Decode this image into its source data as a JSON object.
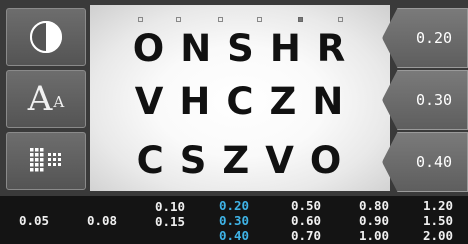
{
  "tools": [
    {
      "name": "contrast-icon"
    },
    {
      "name": "font-size-icon",
      "label_big": "A",
      "label_small": "A"
    },
    {
      "name": "grid-pattern-icon"
    }
  ],
  "chart": {
    "markers": [
      {
        "state": "off"
      },
      {
        "state": "off"
      },
      {
        "state": "off"
      },
      {
        "state": "off"
      },
      {
        "state": "on"
      },
      {
        "state": "off"
      }
    ],
    "rows": [
      {
        "letters": [
          "O",
          "N",
          "S",
          "H",
          "R"
        ]
      },
      {
        "letters": [
          "V",
          "H",
          "C",
          "Z",
          "N"
        ]
      },
      {
        "letters": [
          "C",
          "S",
          "Z",
          "V",
          "O"
        ]
      }
    ]
  },
  "tabs": [
    "0.20",
    "0.30",
    "0.40"
  ],
  "acuity_bar": {
    "highlight_color": "#3fb3e6",
    "columns": [
      {
        "values": [
          "0.05"
        ]
      },
      {
        "values": [
          "0.08"
        ]
      },
      {
        "values": [
          "0.10",
          "0.15"
        ]
      },
      {
        "values": [
          "0.20",
          "0.30",
          "0.40"
        ],
        "highlighted": true
      },
      {
        "values": [
          "0.50",
          "0.60",
          "0.70"
        ]
      },
      {
        "values": [
          "0.80",
          "0.90",
          "1.00"
        ]
      },
      {
        "values": [
          "1.20",
          "1.50",
          "2.00"
        ]
      }
    ]
  }
}
